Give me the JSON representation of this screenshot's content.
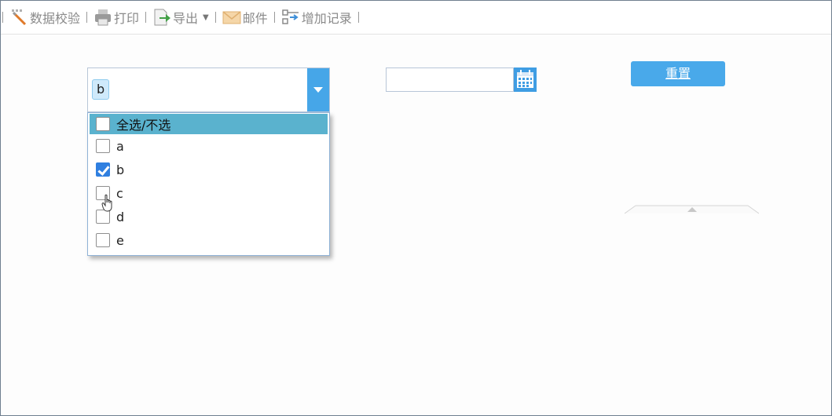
{
  "toolbar": {
    "items": [
      {
        "label": "数据校验",
        "icon": "validate-icon"
      },
      {
        "label": "打印",
        "icon": "printer-icon"
      },
      {
        "label": "导出",
        "icon": "export-icon"
      },
      {
        "label": "邮件",
        "icon": "mail-icon"
      },
      {
        "label": "增加记录",
        "icon": "add-record-icon"
      }
    ]
  },
  "combo": {
    "selected_chip": "b",
    "options_header": "全选/不选",
    "options": [
      {
        "label": "a",
        "checked": false
      },
      {
        "label": "b",
        "checked": true
      },
      {
        "label": "c",
        "checked": false
      },
      {
        "label": "d",
        "checked": false
      },
      {
        "label": "e",
        "checked": false
      }
    ]
  },
  "date": {
    "value": ""
  },
  "reset": {
    "label": "重置"
  },
  "colors": {
    "accent": "#46a6e8",
    "header_row": "#5ab2ce",
    "checked": "#2f7fe0",
    "chip_bg": "#cfeafb"
  }
}
